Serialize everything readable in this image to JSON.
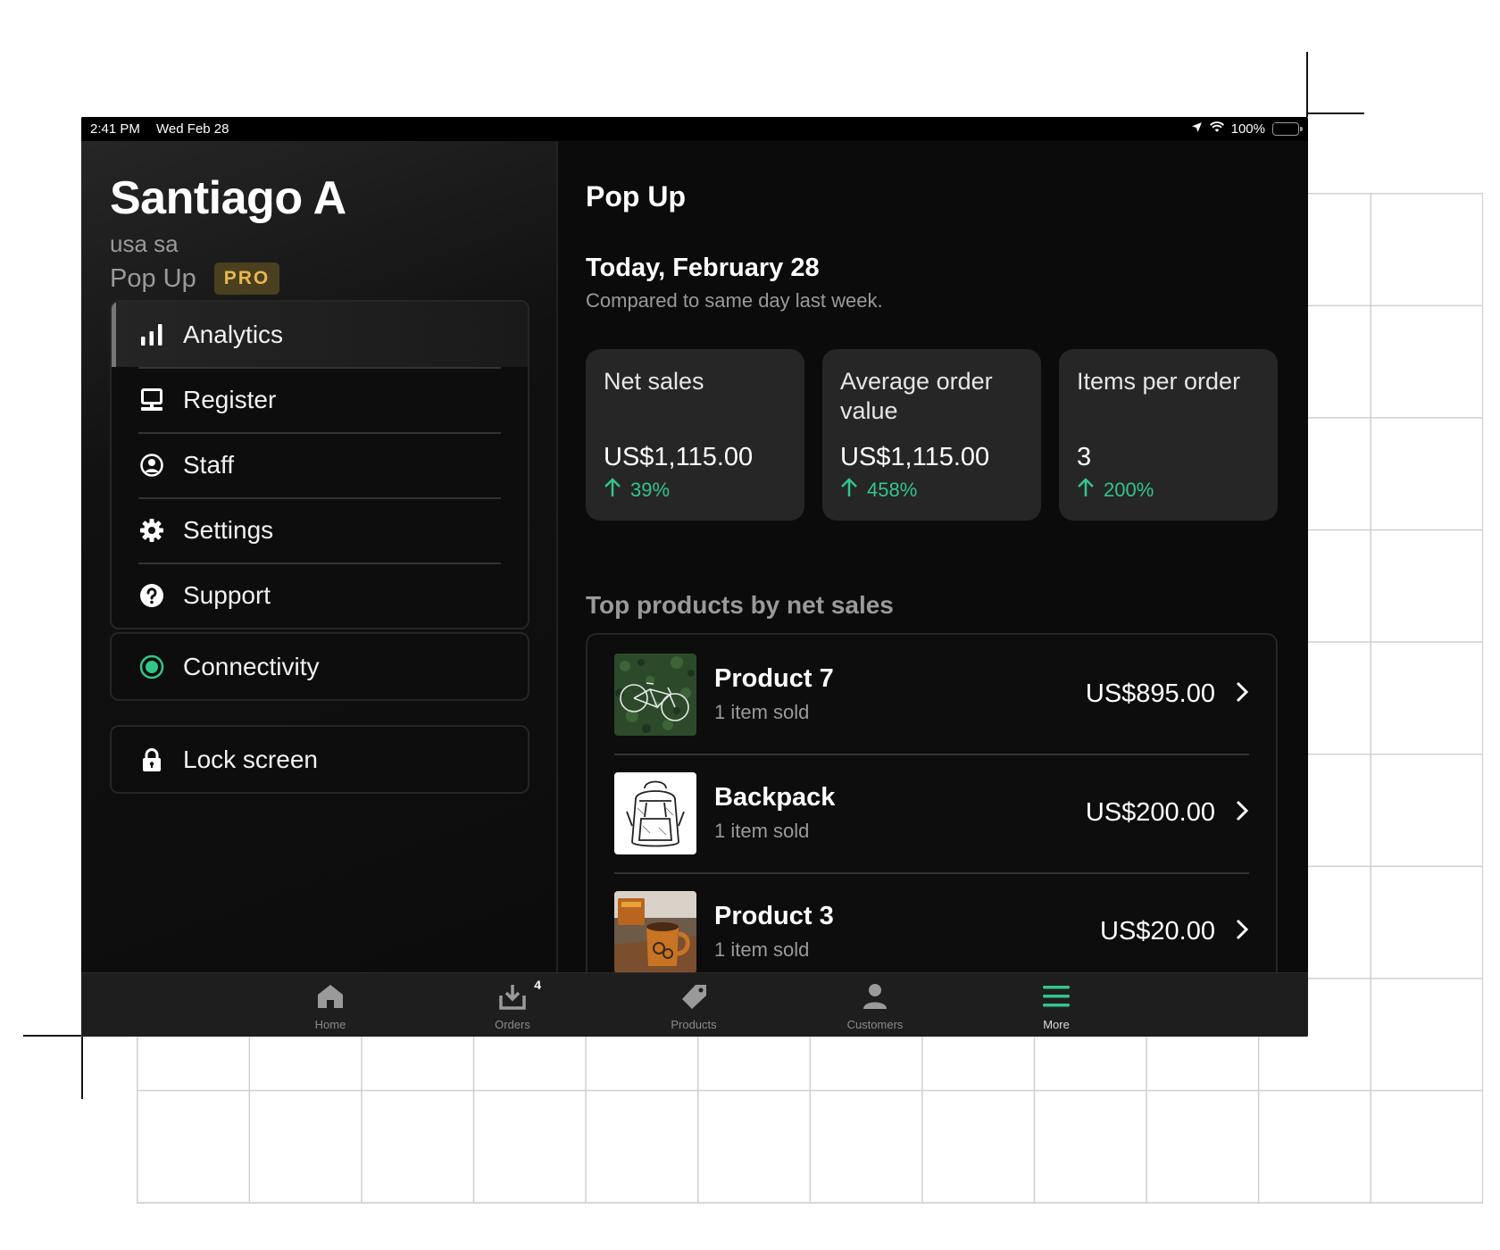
{
  "status_bar": {
    "time": "2:41 PM",
    "date": "Wed Feb 28",
    "battery": "100%"
  },
  "sidebar": {
    "user_name": "Santiago A",
    "user_sub": "usa sa",
    "store_name": "Pop Up",
    "badge": "PRO",
    "menu": [
      {
        "label": "Analytics",
        "icon": "bar-chart-icon"
      },
      {
        "label": "Register",
        "icon": "register-icon"
      },
      {
        "label": "Staff",
        "icon": "staff-icon"
      },
      {
        "label": "Settings",
        "icon": "gear-icon"
      },
      {
        "label": "Support",
        "icon": "help-icon"
      }
    ],
    "connectivity": "Connectivity",
    "lock_screen": "Lock screen"
  },
  "main": {
    "title": "Pop Up",
    "date_title": "Today, February 28",
    "date_sub": "Compared to same day last week.",
    "cards": [
      {
        "title": "Net sales",
        "value": "US$1,115.00",
        "delta": "39%"
      },
      {
        "title": "Average order value",
        "value": "US$1,115.00",
        "delta": "458%"
      },
      {
        "title": "Items per order",
        "value": "3",
        "delta": "200%"
      }
    ],
    "section_title": "Top products by net sales",
    "products": [
      {
        "name": "Product 7",
        "sub": "1 item sold",
        "price": "US$895.00"
      },
      {
        "name": "Backpack",
        "sub": "1 item sold",
        "price": "US$200.00"
      },
      {
        "name": "Product 3",
        "sub": "1 item sold",
        "price": "US$20.00"
      }
    ]
  },
  "tabbar": {
    "tabs": [
      {
        "label": "Home",
        "icon": "home-icon"
      },
      {
        "label": "Orders",
        "icon": "orders-icon",
        "badge": "4"
      },
      {
        "label": "Products",
        "icon": "tag-icon"
      },
      {
        "label": "Customers",
        "icon": "person-icon"
      },
      {
        "label": "More",
        "icon": "menu-icon"
      }
    ]
  },
  "colors": {
    "accent_green": "#33c58a",
    "pro_badge": "#e8b84d"
  }
}
